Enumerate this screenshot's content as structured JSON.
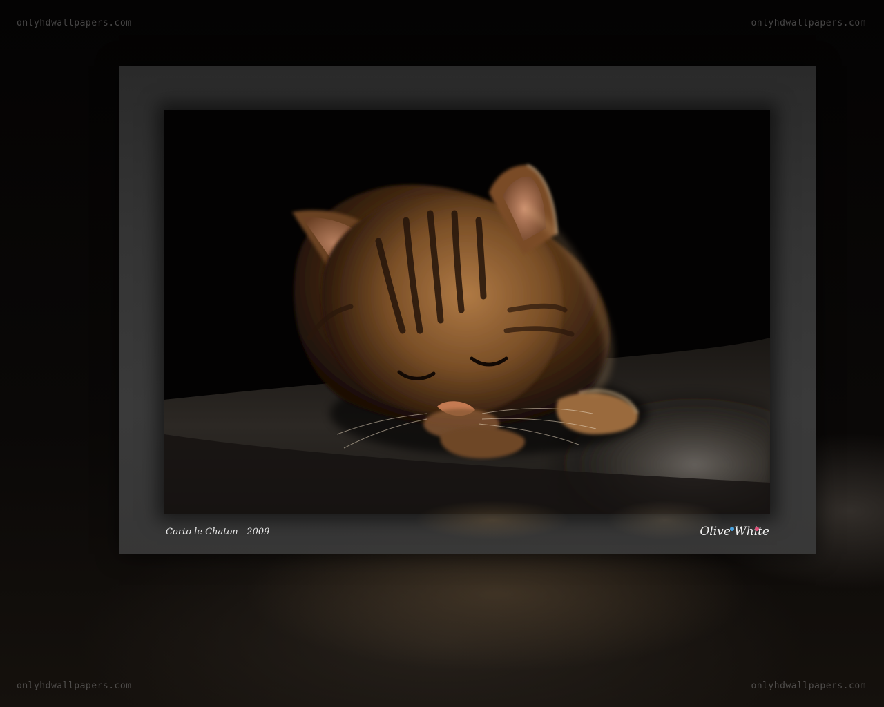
{
  "watermarks": {
    "top_left": "onlyhdwallpapers.com",
    "top_right": "onlyhdwallpapers.com",
    "bottom_left": "onlyhdwallpapers.com",
    "bottom_right": "onlyhdwallpapers.com"
  },
  "frame": {
    "title": "Corto le Chaton - 2009",
    "signature": "Olive White"
  },
  "photo": {
    "subject": "kitten-sleeping-on-fur-rug"
  },
  "colors": {
    "background": "#050403",
    "frame": "#363636",
    "caption_text": "#e8e8e8",
    "signature_dot_blue": "#4aa3e0",
    "signature_dot_pink": "#e0507a"
  }
}
